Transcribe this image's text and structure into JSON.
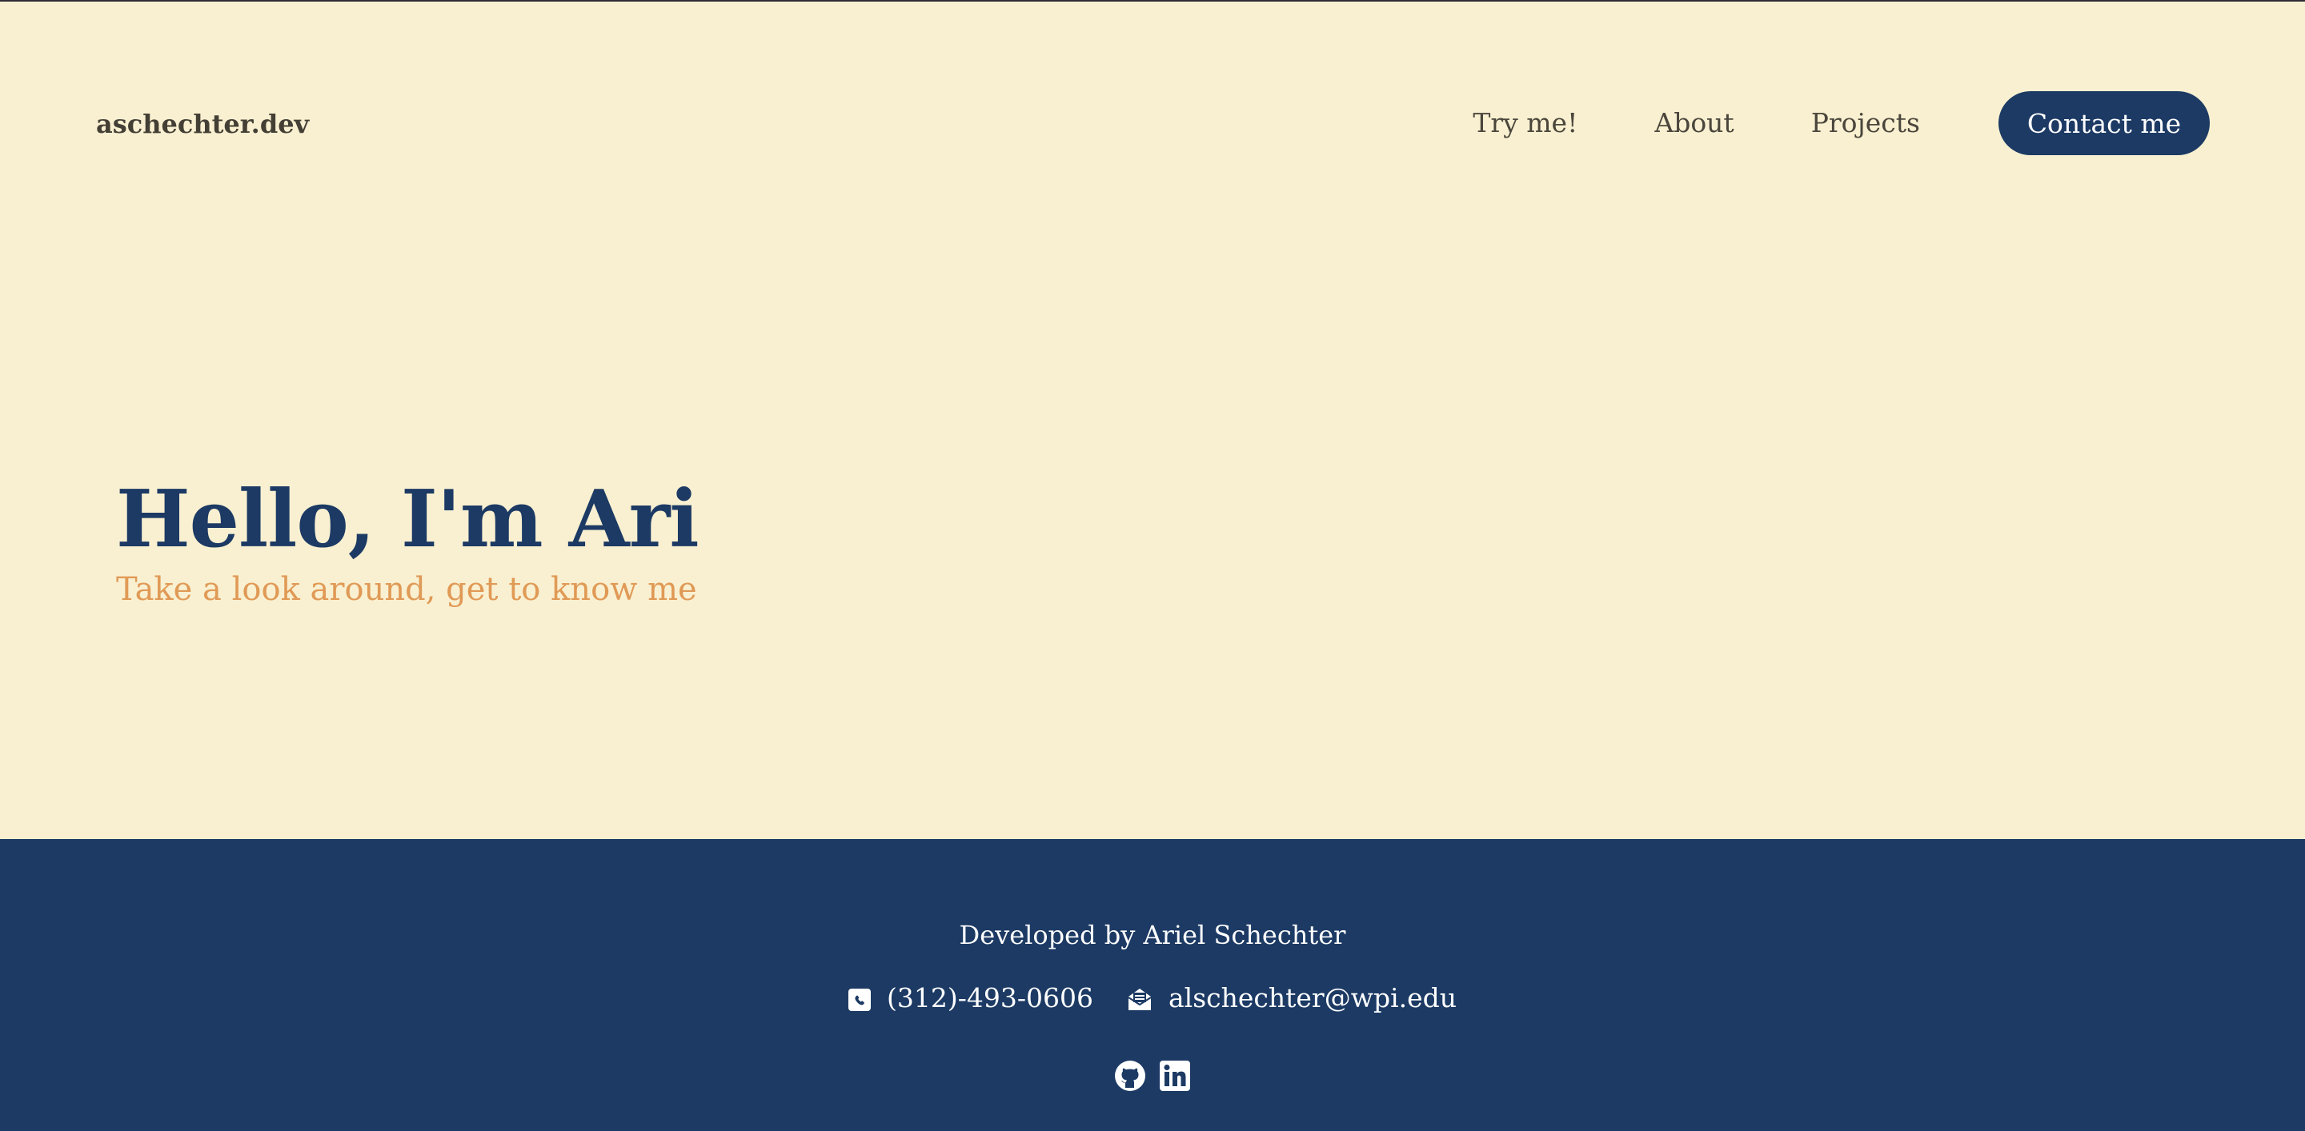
{
  "header": {
    "brand": "aschechter.dev",
    "nav": [
      {
        "label": "Try me!"
      },
      {
        "label": "About"
      },
      {
        "label": "Projects"
      }
    ],
    "contact_button": "Contact me"
  },
  "hero": {
    "title": "Hello, I'm Ari",
    "subtitle": "Take a look around, get to know me"
  },
  "footer": {
    "credit": "Developed by Ariel Schechter",
    "phone": "(312)-493-0606",
    "email": "alschechter@wpi.edu",
    "icons": {
      "phone": "phone-icon",
      "email": "envelope-open-icon",
      "github": "github-icon",
      "linkedin": "linkedin-icon"
    }
  },
  "colors": {
    "background": "#f9f0d1",
    "primary": "#1c3a64",
    "accent": "#e09a56",
    "text": "#443f35"
  }
}
